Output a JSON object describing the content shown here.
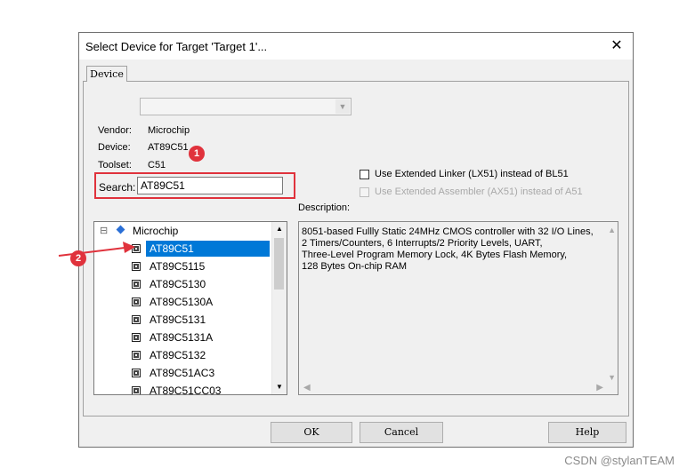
{
  "window": {
    "title": "Select Device for Target 'Target 1'...",
    "close_glyph": "✕"
  },
  "tab": {
    "label": "Device"
  },
  "info": {
    "vendor_label": "Vendor:",
    "vendor_value": "Microchip",
    "device_label": "Device:",
    "device_value": "AT89C51",
    "toolset_label": "Toolset:",
    "toolset_value": "C51"
  },
  "search": {
    "label": "Search:",
    "value": "AT89C51"
  },
  "options": {
    "linker": "Use Extended Linker (LX51) instead of BL51",
    "assembler": "Use Extended Assembler (AX51) instead of A51"
  },
  "description": {
    "label": "Description:",
    "lines": [
      "8051-based Fullly Static 24MHz CMOS controller with 32  I/O Lines,",
      "2 Timers/Counters, 6 Interrupts/2 Priority Levels, UART,",
      "Three-Level Program Memory Lock, 4K Bytes Flash Memory,",
      "128 Bytes On-chip RAM"
    ]
  },
  "tree": {
    "vendor": "Microchip",
    "collapse_glyph": "⊟",
    "devices": [
      "AT89C51",
      "AT89C5115",
      "AT89C5130",
      "AT89C5130A",
      "AT89C5131",
      "AT89C5131A",
      "AT89C5132",
      "AT89C51AC3",
      "AT89C51CC03"
    ],
    "selected": "AT89C51"
  },
  "buttons": {
    "ok": "OK",
    "cancel": "Cancel",
    "help": "Help"
  },
  "annotations": {
    "badge_1": "1",
    "badge_2": "2"
  },
  "colors": {
    "selection": "#0078d7",
    "annotation": "#e0323c"
  },
  "watermark": "CSDN @stylanTEAM"
}
